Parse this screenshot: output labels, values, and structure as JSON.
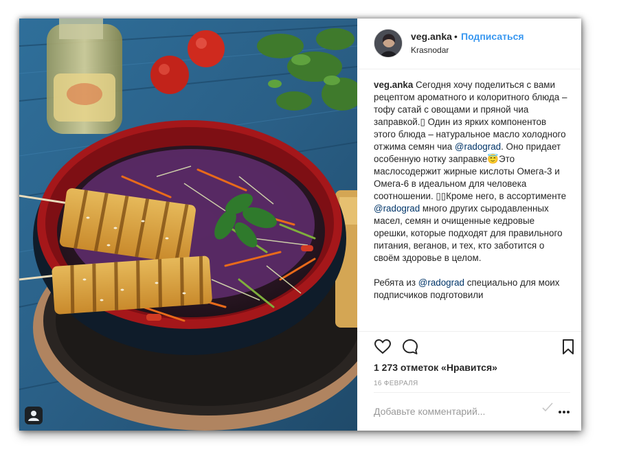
{
  "post": {
    "username": "veg.anka",
    "separator": "•",
    "follow_label": "Подписаться",
    "location": "Krasnodar",
    "caption": {
      "username": "veg.anka",
      "seg1": " Сегодня хочу поделиться с вами рецептом ароматного и колоритного блюда – тофу сатай с овощами и пряной чиа заправкой.▯ Один из ярких компонентов этого блюда – натуральное масло холодного отжима семян чиа ",
      "mention1": "@radograd",
      "seg2": ". Оно придает особенную нотку заправке😇Это маслосодержит жирные кислоты Омега-3 и Омега-6 в идеальном для человека соотношении. ▯▯Кроме него, в ассортименте ",
      "mention2": "@radograd",
      "seg3": " много других сыродавленных масел, семян и очищенные кедровые орешки, которые подходят для правильного питания, веганов, и тех, кто заботится о своём здоровье в целом.",
      "p2_seg1": "Ребята из ",
      "mention3": "@radograd",
      "p2_seg2": " специально для моих подписчиков подготовили"
    },
    "likes_text": "1 273 отметок «Нравится»",
    "date": "16 ФЕВРАЛЯ",
    "comment_placeholder": "Добавьте комментарий..."
  },
  "icons": {
    "like": "heart-outline-icon",
    "comment": "speech-bubble-icon",
    "save": "bookmark-icon",
    "more": "ellipsis-icon",
    "user_tag": "person-icon",
    "spell": "spellcheck-icon"
  },
  "colors": {
    "link_blue": "#3897f0",
    "mention": "#003569",
    "muted": "#999999",
    "text": "#262626"
  }
}
